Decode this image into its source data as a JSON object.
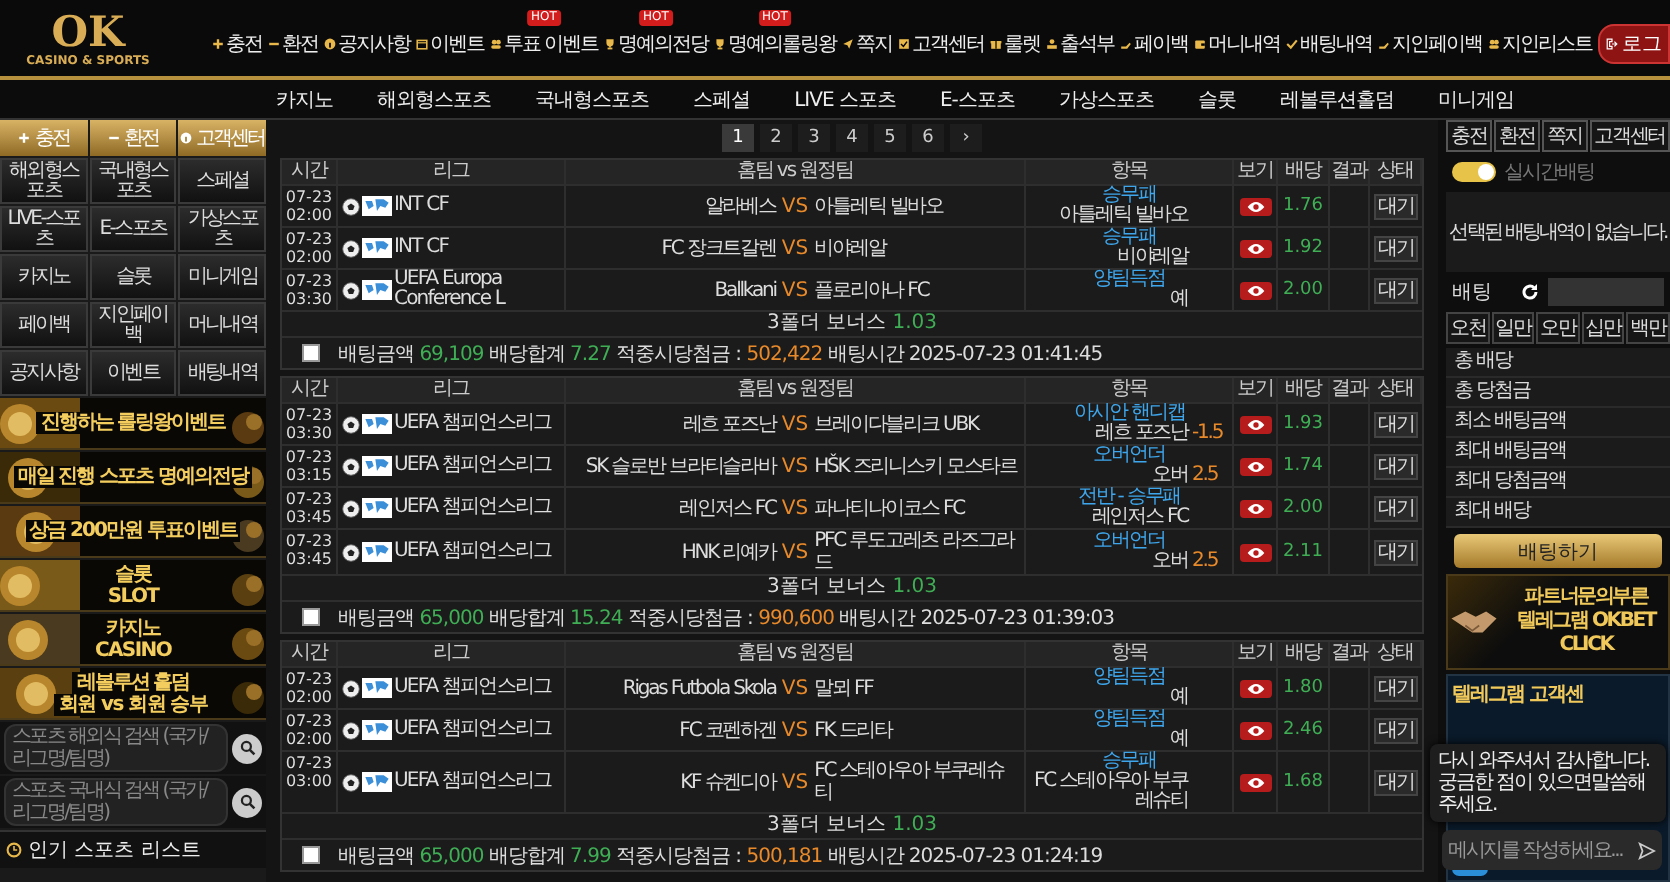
{
  "header": {
    "logo": "OK",
    "tagline": "CASINO & SPORTS",
    "links": [
      {
        "label": "충전"
      },
      {
        "label": "환전"
      },
      {
        "label": "공지사항"
      },
      {
        "label": "이벤트"
      },
      {
        "label": "투표 이벤트",
        "badge": "HOT"
      },
      {
        "label": "명예의전당",
        "badge": "HOT"
      },
      {
        "label": "명예의롤링왕",
        "badge": "HOT"
      },
      {
        "label": "쪽지"
      },
      {
        "label": "고객센터"
      },
      {
        "label": "룰렛"
      },
      {
        "label": "출석부"
      },
      {
        "label": "페이백"
      },
      {
        "label": "머니내역"
      },
      {
        "label": "배팅내역"
      },
      {
        "label": "지인페이백"
      },
      {
        "label": "지인리스트"
      }
    ],
    "login_button": "로그"
  },
  "main_nav": [
    "카지노",
    "해외형스포츠",
    "국내형스포츠",
    "스페셜",
    "LIVE 스포츠",
    "E-스포츠",
    "가상스포츠",
    "슬롯",
    "레볼루션홀덤",
    "미니게임"
  ],
  "sidebar": {
    "quick_buttons": [
      "충전",
      "환전",
      "고객센터"
    ],
    "menu": [
      "해외형스포츠",
      "국내형스포츠",
      "스페셜",
      "LIVE-스포츠",
      "E-스포츠",
      "가상스포츠",
      "카지노",
      "슬롯",
      "미니게임",
      "페이백",
      "지인페이백",
      "머니내역",
      "공지사항",
      "이벤트",
      "배팅내역"
    ],
    "banners": [
      {
        "title": "진행하는 롤링왕이벤트"
      },
      {
        "title": "매일 진행 스포츠 명예의전당"
      },
      {
        "title": "상금 200만원 투표이벤트"
      },
      {
        "title": "슬롯",
        "subtitle": "SLOT"
      },
      {
        "title": "카지노",
        "subtitle": "CASINO"
      },
      {
        "title": "레볼루션 홀덤",
        "subtitle": "회원 vs 회원 승부"
      }
    ],
    "searches": [
      {
        "placeholder": "스포츠 해외식 검색 (국가/리그명/팀명)"
      },
      {
        "placeholder": "스포츠 국내식 검색 (국가/리그명/팀명)"
      }
    ],
    "popular_title": "인기 스포츠 리스트"
  },
  "pagination": {
    "pages": [
      {
        "label": "1",
        "selected": true
      },
      {
        "label": "2",
        "selected": false
      },
      {
        "label": "3",
        "selected": false
      },
      {
        "label": "4",
        "selected": false
      },
      {
        "label": "5",
        "selected": false
      },
      {
        "label": "6",
        "selected": false
      }
    ],
    "next": "›"
  },
  "bet_slips": [
    {
      "columns": [
        "시간",
        "리그",
        "홈팀 vs 원정팀",
        "항목",
        "보기",
        "배당",
        "결과",
        "상태"
      ],
      "rows": [
        {
          "date": "07-23",
          "clock": "02:00",
          "league": "INT CF",
          "home": "알라베스",
          "vs": "VS",
          "away": "아틀레틱 빌바오",
          "market": "승무패",
          "pick": "아틀레틱 빌바오",
          "odds": "1.76",
          "status": "대기"
        },
        {
          "date": "07-23",
          "clock": "02:00",
          "league": "INT CF",
          "home": "FC 장크트갈렌",
          "vs": "VS",
          "away": "비야레알",
          "market": "승무패",
          "pick": "비야레알",
          "odds": "1.92",
          "status": "대기"
        },
        {
          "date": "07-23",
          "clock": "03:30",
          "league": "UEFA Europa Conference L",
          "home": "Ballkani",
          "vs": "VS",
          "away": "플로리아나 FC",
          "market": "양팀득점",
          "pick": "예",
          "odds": "2.00",
          "status": "대기"
        }
      ],
      "bonus_label": "3폴더 보너스",
      "bonus_value": "1.03",
      "summary": {
        "checked": false,
        "amount_label": "배팅금액",
        "amount": "69,109",
        "odds_label": "배당합계",
        "odds": "7.27",
        "payout_label": "적중시당첨금 :",
        "payout": "502,422",
        "time_label": "배팅시간",
        "time": "2025-07-23 01:41:45"
      }
    },
    {
      "columns": [
        "시간",
        "리그",
        "홈팀 vs 원정팀",
        "항목",
        "보기",
        "배당",
        "결과",
        "상태"
      ],
      "rows": [
        {
          "date": "07-23",
          "clock": "03:30",
          "league": "UEFA 챔피언스리그",
          "home": "레흐 포즈난",
          "vs": "VS",
          "away": "브레이다블리크 UBK",
          "market": "아시안 핸디캡",
          "pick": "레흐 포즈난",
          "line": "-1.5",
          "odds": "1.93",
          "status": "대기"
        },
        {
          "date": "07-23",
          "clock": "03:15",
          "league": "UEFA 챔피언스리그",
          "home": "SK 슬로반 브라티슬라바",
          "vs": "VS",
          "away": "HŠK 즈리니스키 모스타르",
          "market": "오버언더",
          "pick": "오버",
          "line": "2.5",
          "odds": "1.74",
          "status": "대기"
        },
        {
          "date": "07-23",
          "clock": "03:45",
          "league": "UEFA 챔피언스리그",
          "home": "레인저스 FC",
          "vs": "VS",
          "away": "파나티나이코스 FC",
          "market": "전반 - 승무패",
          "pick": "레인저스 FC",
          "odds": "2.00",
          "status": "대기"
        },
        {
          "date": "07-23",
          "clock": "03:45",
          "league": "UEFA 챔피언스리그",
          "home": "HNK 리예카",
          "vs": "VS",
          "away": "PFC 루도고레츠 라즈그라드",
          "market": "오버언더",
          "pick": "오버",
          "line": "2.5",
          "odds": "2.11",
          "status": "대기"
        }
      ],
      "bonus_label": "3폴더 보너스",
      "bonus_value": "1.03",
      "summary": {
        "checked": false,
        "amount_label": "배팅금액",
        "amount": "65,000",
        "odds_label": "배당합계",
        "odds": "15.24",
        "payout_label": "적중시당첨금 :",
        "payout": "990,600",
        "time_label": "배팅시간",
        "time": "2025-07-23 01:39:03"
      }
    },
    {
      "columns": [
        "시간",
        "리그",
        "홈팀 vs 원정팀",
        "항목",
        "보기",
        "배당",
        "결과",
        "상태"
      ],
      "rows": [
        {
          "date": "07-23",
          "clock": "02:00",
          "league": "UEFA 챔피언스리그",
          "home": "Rigas Futbola Skola",
          "vs": "VS",
          "away": "말뫼 FF",
          "market": "양팀득점",
          "pick": "예",
          "odds": "1.80",
          "status": "대기"
        },
        {
          "date": "07-23",
          "clock": "02:00",
          "league": "UEFA 챔피언스리그",
          "home": "FC 코펜하겐",
          "vs": "VS",
          "away": "FK 드리타",
          "market": "양팀득점",
          "pick": "예",
          "odds": "2.46",
          "status": "대기"
        },
        {
          "date": "07-23",
          "clock": "03:00",
          "league": "UEFA 챔피언스리그",
          "home": "KF 슈켄디아",
          "vs": "VS",
          "away": "FC 스테아우아 부쿠레슈티",
          "market": "승무패",
          "pick": "FC 스테아우아 부쿠레슈티",
          "odds": "1.68",
          "status": "대기"
        }
      ],
      "bonus_label": "3폴더 보너스",
      "bonus_value": "1.03",
      "summary": {
        "checked": false,
        "amount_label": "배팅금액",
        "amount": "65,000",
        "odds_label": "배당합계",
        "odds": "7.99",
        "payout_label": "적중시당첨금 :",
        "payout": "500,181",
        "time_label": "배팅시간",
        "time": "2025-07-23 01:24:19"
      }
    }
  ],
  "bet_panel": {
    "tabs": [
      "충전",
      "환전",
      "쪽지",
      "고객센터"
    ],
    "live_toggle": {
      "label": "실시간배팅",
      "on": true
    },
    "empty_message": "선택된 배팅내역이 없습니다.",
    "bet_label": "배팅",
    "amounts": [
      "오천",
      "일만",
      "오만",
      "십만",
      "백만"
    ],
    "totals": [
      "총 배당",
      "총 당첨금",
      "최소 배팅금액",
      "최대 배팅금액",
      "최대 당첨금액",
      "최대 배당"
    ],
    "submit": "배팅하기"
  },
  "partner_banner": {
    "lines": [
      "파트너문의부른",
      "텔레그램 OKBET",
      "CLICK"
    ]
  },
  "telegram_banner": {
    "title": "텔레그램 고객센"
  },
  "chat": {
    "message": "다시 와주셔서 감사합니다. 궁금한 점이 있으면말씀해주세요.",
    "placeholder": "메시지를 작성하세요..."
  }
}
